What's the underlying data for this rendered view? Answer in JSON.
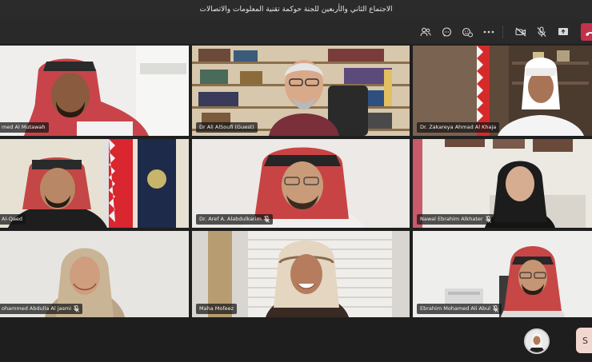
{
  "window": {
    "title": "الاجتماع الثاني والأربعين للجنة حوكمة تقنية المعلومات والاتصالات"
  },
  "toolbar": {
    "icons": [
      "participants-icon",
      "chat-icon",
      "reactions-icon",
      "more-options-icon",
      "camera-off-icon",
      "mic-off-icon",
      "share-screen-icon",
      "leave-call-icon"
    ]
  },
  "participants": [
    {
      "name": "med Al Mutawah",
      "muted": false
    },
    {
      "name": "Dr Ali AlSoufi (Guest)",
      "muted": false
    },
    {
      "name": "Dr. Zakareya Ahmad Al Khaja",
      "muted": false
    },
    {
      "name": "Al-Qaed",
      "muted": false
    },
    {
      "name": "Dr. Aref A. Alabdulkarim",
      "muted": true
    },
    {
      "name": "Nawal Ebrahim Alkhater",
      "muted": true
    },
    {
      "name": "ohammed Abdulla Al jasmi",
      "muted": true
    },
    {
      "name": "Maha Mofeez",
      "muted": false
    },
    {
      "name": "Ebrahim Mohamed Ali Abul",
      "muted": true
    }
  ],
  "bottom": {
    "side_chip_letter": "S"
  },
  "colors": {
    "leave": "#c4314b",
    "toolbar": "#292929",
    "titlebar": "#2b2b2b"
  }
}
